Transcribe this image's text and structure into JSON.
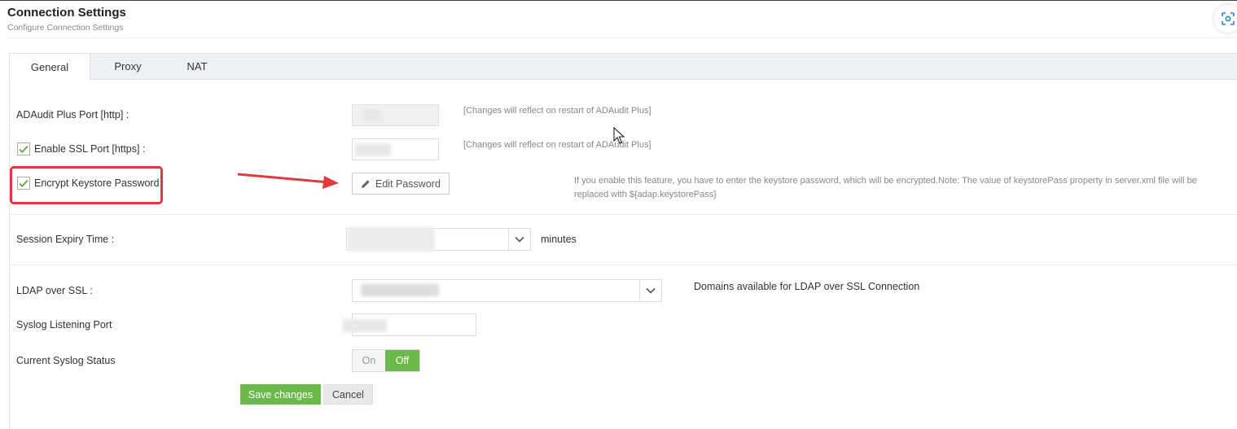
{
  "header": {
    "title": "Connection Settings",
    "subtitle": "Configure Connection Settings"
  },
  "tabs": [
    {
      "label": "General",
      "active": true
    },
    {
      "label": "Proxy",
      "active": false
    },
    {
      "label": "NAT",
      "active": false
    }
  ],
  "form": {
    "http_port": {
      "label": "ADAudit Plus Port [http] :",
      "hint": "[Changes will reflect on restart of ADAudit Plus]"
    },
    "ssl_port": {
      "label": "Enable SSL Port [https] :",
      "checked": true,
      "hint": "[Changes will reflect on restart of ADAudit Plus]"
    },
    "encrypt_keystore": {
      "label": "Encrypt Keystore Password",
      "checked": true,
      "button_label": "Edit Password",
      "hint": "If you enable this feature, you have to enter the keystore password, which will be encrypted.Note: The value of keystorePass property in server.xml file will be replaced with ${adap.keystorePass}"
    },
    "session_expiry": {
      "label": "Session Expiry Time :",
      "unit": "minutes"
    },
    "ldap_ssl": {
      "label": "LDAP over SSL :",
      "hint": "Domains available for LDAP over SSL Connection"
    },
    "syslog_port": {
      "label": "Syslog Listening Port"
    },
    "syslog_status": {
      "label": "Current Syslog Status",
      "on_label": "On",
      "off_label": "Off",
      "value": "Off"
    }
  },
  "actions": {
    "save_label": "Save changes",
    "cancel_label": "Cancel"
  },
  "colors": {
    "accent_green": "#6cb94b",
    "highlight_red": "#e0393e"
  },
  "icons": {
    "focus": "focus-scan-icon",
    "edit": "pencil-icon",
    "check": "checkmark-icon",
    "dropdown": "chevron-down-icon",
    "annotation": "red-arrow-icon"
  }
}
